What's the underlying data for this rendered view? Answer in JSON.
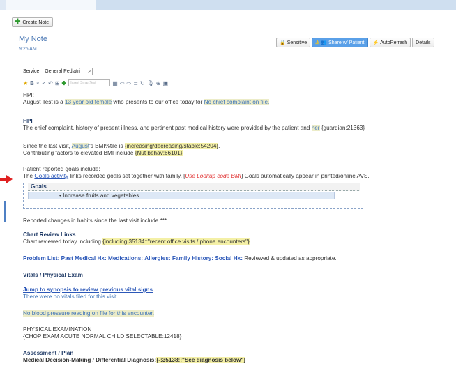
{
  "toolbar": {
    "create_note": "Create Note"
  },
  "note": {
    "title": "My Note",
    "time": "9:26 AM",
    "actions": {
      "sensitive": "Sensitive",
      "share": "Share w/ Patient",
      "autorefresh": "AutoRefresh",
      "details": "Details"
    },
    "service_label": "Service:",
    "service_value": "General Pediatri",
    "smarttext_placeholder": "Insert SmartText"
  },
  "content": {
    "hpi_label": "HPI:",
    "hpi_p1": "August Test is a ",
    "hpi_age": "13 year old female",
    "hpi_p2": " who presents to our office today for ",
    "hpi_complaint": "No chief complaint on file.",
    "hpi_heading": "HPI",
    "hpi_text1": "The chief complaint, history of present illness, and pertinent past medical history were provided by the patient and ",
    "hpi_her": "her",
    "hpi_guardian": " {guardian:21363}",
    "bmi_p1": "Since the last visit, ",
    "bmi_name": "August",
    "bmi_p2": "'s BMI%tile is ",
    "bmi_token": "{increasing/decreasing/stable:54204}",
    "bmi_p3": ".",
    "contrib_p1": "Contributing factors to elevated BMI include ",
    "contrib_token": "{Nut behav:66101}",
    "goals_intro": "Patient reported goals include:",
    "goals_p1": "The ",
    "goals_link": "Goals activity",
    "goals_p2": " links recorded goals set together with family. [",
    "goals_red": "Use Lookup code BMI",
    "goals_p3": "] Goals automatically appear in printed/online AVS.",
    "goals_header": "Goals",
    "goals_item": "Increase fruits and vegetables",
    "habits": "Reported changes in habits since the last visit include ***.",
    "chart_review_heading": "Chart Review Links",
    "chart_review_p1": "Chart reviewed today including ",
    "chart_review_token": "{including:35134::\"recent office visits / phone encounters\"}",
    "links": [
      "Problem List:",
      "Past Medical Hx:",
      "Medications:",
      "Allergies:",
      "Family History:",
      "Social Hx:"
    ],
    "links_tail": " Reviewed & updated as appropriate.",
    "vitals_heading": "Vitals / Physical Exam",
    "vitals_link": "Jump to synopsis to review previous vital signs",
    "vitals_none": "There were no vitals filed for this visit.",
    "bp": "No blood pressure reading on file for this encounter.",
    "pe_heading": "PHYSICAL EXAMINATION",
    "pe_token": "{CHOP EXAM ACUTE NORMAL CHILD SELECTABLE:12418}",
    "ap_heading": "Assessment / Plan",
    "mdm_label": "Medical Decision-Making / Differential Diagnosis:",
    "mdm_token": "{-:35138::\"See diagnosis below\"}"
  }
}
